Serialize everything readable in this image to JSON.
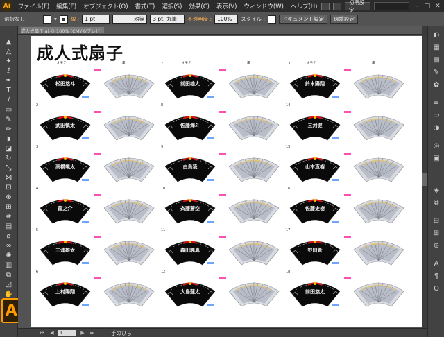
{
  "app": {
    "logo": "Ai",
    "menu": [
      "ファイル(F)",
      "編集(E)",
      "オブジェクト(O)",
      "書式(T)",
      "選択(S)",
      "効果(C)",
      "表示(V)",
      "ウィンドウ(W)",
      "ヘルプ(H)"
    ],
    "workspace_label": "初期設定",
    "brand_color": "#ff9a00"
  },
  "controlbar": {
    "selection_label": "選択なし",
    "stroke_label": "線 :",
    "stroke_weight": "1 pt",
    "stroke_profile": "均等",
    "brush": "3 pt. 丸筆",
    "opacity_label": "不透明度 :",
    "opacity_value": "100%",
    "style_label": "スタイル :",
    "doc_settings_button": "ドキュメント設定",
    "preferences_button": "環境設定"
  },
  "document": {
    "tab_title": "成人式扇子.ai @ 100% (CMYK/プレビュー)",
    "title": "成人式扇子",
    "front_label": "オモテ",
    "back_label": "裏",
    "items": [
      {
        "num": "1",
        "name": "松田悠斗"
      },
      {
        "num": "2",
        "name": "武田慎太"
      },
      {
        "num": "3",
        "name": "高橋颯太"
      },
      {
        "num": "4",
        "name": "龍之介"
      },
      {
        "num": "5",
        "name": "三浦雄太"
      },
      {
        "num": "6",
        "name": "上村陽翔"
      },
      {
        "num": "7",
        "name": "前田雄大"
      },
      {
        "num": "8",
        "name": "佐藤海斗"
      },
      {
        "num": "9",
        "name": "白鳥凌"
      },
      {
        "num": "10",
        "name": "斉藤蒼空"
      },
      {
        "num": "11",
        "name": "森田颯真"
      },
      {
        "num": "12",
        "name": "大島蓮太"
      },
      {
        "num": "13",
        "name": "鈴木陽翔"
      },
      {
        "num": "14",
        "name": "三河健"
      },
      {
        "num": "15",
        "name": "山本直樹"
      },
      {
        "num": "16",
        "name": "佐藤史樹"
      },
      {
        "num": "17",
        "name": "野田蒼"
      },
      {
        "num": "18",
        "name": "前田悠太"
      }
    ]
  },
  "statusbar": {
    "zoom_nav": "1",
    "tool_name": "手のひら"
  }
}
